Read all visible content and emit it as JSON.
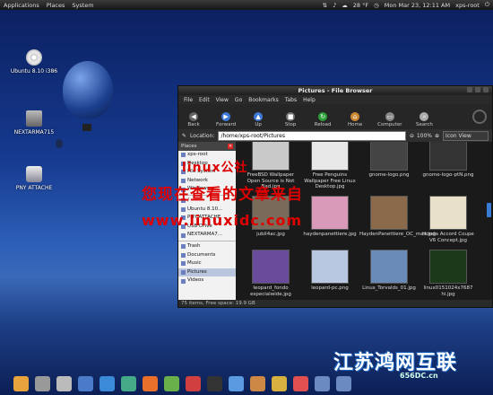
{
  "topbar": {
    "menus": [
      "Applications",
      "Places",
      "System"
    ],
    "temperature": "28 °F",
    "clock": "Mon Mar 23, 12:11 AM",
    "user": "xps-root"
  },
  "desktop": {
    "icons": [
      {
        "label": "Ubuntu 8.10 i386",
        "kind": "cd-icon"
      },
      {
        "label": "NEXTARMA715",
        "kind": "computer-icon"
      },
      {
        "label": "PNY ATTACHE",
        "kind": "usb-drive-icon"
      }
    ]
  },
  "window": {
    "title": "Pictures - File Browser",
    "menu": [
      "File",
      "Edit",
      "View",
      "Go",
      "Bookmarks",
      "Tabs",
      "Help"
    ],
    "toolbar": [
      {
        "label": "Back",
        "color": "#666666",
        "glyph": "◀"
      },
      {
        "label": "Forward",
        "color": "#3c78d8",
        "glyph": "▶"
      },
      {
        "label": "Up",
        "color": "#3c78d8",
        "glyph": "▲"
      },
      {
        "label": "Stop",
        "color": "#777777",
        "glyph": "■"
      },
      {
        "label": "Reload",
        "color": "#2e9e3a",
        "glyph": "↻"
      },
      {
        "label": "Home",
        "color": "#cc8833",
        "glyph": "⌂"
      },
      {
        "label": "Computer",
        "color": "#888888",
        "glyph": "▭"
      },
      {
        "label": "Search",
        "color": "#aaaaaa",
        "glyph": "⌕"
      }
    ],
    "location_label": "Location:",
    "location_value": "/home/xps-root/Pictures",
    "zoom": "100%",
    "view_mode": "Icon View",
    "sidebar": {
      "header": "Places",
      "items": [
        {
          "label": "xps-root",
          "selected": false
        },
        {
          "label": "Desktop",
          "selected": false
        },
        {
          "label": "File System",
          "selected": false
        },
        {
          "label": "Network",
          "selected": false
        },
        {
          "label": "Windows...",
          "selected": false
        },
        {
          "label": "/",
          "selected": false
        },
        {
          "label": "Ubuntu 8.10...",
          "selected": false
        },
        {
          "label": "PNY ATTACHE",
          "selected": false
        },
        {
          "label": "USB Drive",
          "selected": false
        },
        {
          "label": "NEXTARMA7...",
          "selected": false
        },
        {
          "label": "Trash",
          "selected": false
        },
        {
          "label": "Documents",
          "selected": false
        },
        {
          "label": "Music",
          "selected": false
        },
        {
          "label": "Pictures",
          "selected": true
        },
        {
          "label": "Videos",
          "selected": false
        }
      ]
    },
    "files": [
      {
        "name": "FreeBSD Wallpaper Open Source is Not Bad.jpg",
        "color": "#c9c9c9"
      },
      {
        "name": "Free Penguins Wallpaper Free Linux Desktop.jpg",
        "color": "#e8e8e8"
      },
      {
        "name": "gnome-logo.png",
        "color": "#444444"
      },
      {
        "name": "gnome-logo-ptN.png",
        "color": "#333333"
      },
      {
        "name": "jubil4ac.jpg",
        "color": "#7a6a5a"
      },
      {
        "name": "haydenpanettiere.jpg",
        "color": "#d89ab8"
      },
      {
        "name": "HaydenPanettiere_OC_max.jpg",
        "color": "#8a6a4a"
      },
      {
        "name": "Honda Accord Coupe V6 Concept.jpg",
        "color": "#e8e0c8"
      },
      {
        "name": "leopard_fondo especialwide.jpg",
        "color": "#6a4a9a"
      },
      {
        "name": "leopard-pc.png",
        "color": "#b8c8e0"
      },
      {
        "name": "Linus_Torvalds_01.jpg",
        "color": "#6a8ab8"
      },
      {
        "name": "linux0151024x7687 hi.jpg",
        "color": "#1a3a1a"
      }
    ],
    "status": "75 items, Free space: 19.9 GB"
  },
  "overlays": {
    "watermark_en": "linux公社",
    "watermark_cn": "您现在查看的文章来自",
    "watermark_url": "www.linuxidc.com",
    "brand_cn": "江苏鸿网互联",
    "brand_domain": "656DC.cn"
  },
  "dock": {
    "icons": [
      "folder-icon",
      "trash-icon",
      "printer-icon",
      "mail-icon",
      "dropbox-icon",
      "network-icon",
      "firefox-icon",
      "bug-icon",
      "download-icon",
      "terminal-icon",
      "monitor-icon",
      "chart-icon",
      "box-icon",
      "pen-icon",
      "window-icon",
      "window-icon"
    ]
  }
}
